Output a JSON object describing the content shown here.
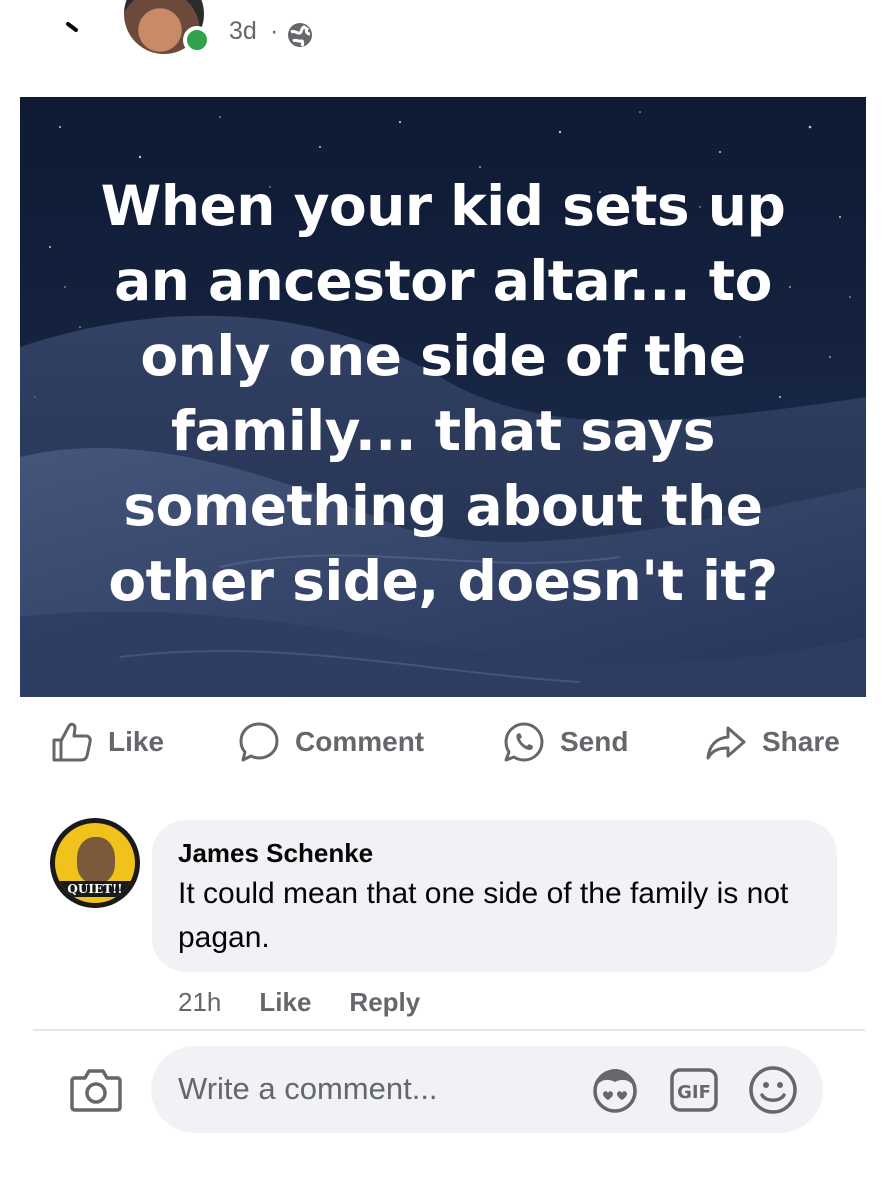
{
  "header": {
    "timestamp": "3d",
    "separator": "·",
    "online_color": "#31a24c"
  },
  "post": {
    "image_text": "When your kid sets up an ancestor altar... to only one side of the family... that says something about the other side, doesn't it?"
  },
  "actions": {
    "like": "Like",
    "comment": "Comment",
    "send": "Send",
    "share": "Share"
  },
  "comment": {
    "author": "James Schenke",
    "text": "It could mean that one side of the family is not pagan.",
    "avatar_label": "QUIET!!",
    "time": "21h",
    "like": "Like",
    "reply": "Reply"
  },
  "composer": {
    "placeholder": "Write a comment..."
  },
  "colors": {
    "secondary_text": "#65676b",
    "bubble_bg": "#f0f2f5",
    "accent_avatar": "#f2c21c"
  }
}
